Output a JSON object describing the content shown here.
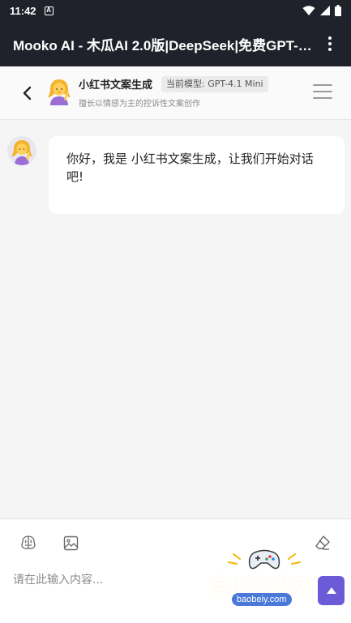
{
  "status_bar": {
    "time": "11:42",
    "app_indicator": "A",
    "icons": [
      "wifi-icon",
      "signal-icon",
      "battery-icon"
    ]
  },
  "app_bar": {
    "title": "Mooko AI - 木瓜AI 2.0版|DeepSeek|免费GPT-…",
    "menu_icon": "more-vertical-icon"
  },
  "chat_header": {
    "bot_name": "小红书文案生成",
    "model_badge": "当前模型: GPT-4.1 Mini",
    "description": "擅长以情感为主的控诉性文案创作"
  },
  "messages": [
    {
      "sender": "bot",
      "text": "你好，我是 小红书文案生成，让我们开始对话吧!"
    }
  ],
  "input": {
    "placeholder": "请在此输入内容...",
    "value": "",
    "tools": [
      "brain-icon",
      "image-icon",
      "eraser-icon"
    ]
  },
  "watermark": {
    "title": "宝贝游戏网",
    "url": "baobeiy.com"
  },
  "colors": {
    "bar_bg": "#1f222a",
    "accent": "#6b5bd6",
    "bubble_bg": "#ffffff",
    "page_bg": "#f5f5f5"
  }
}
